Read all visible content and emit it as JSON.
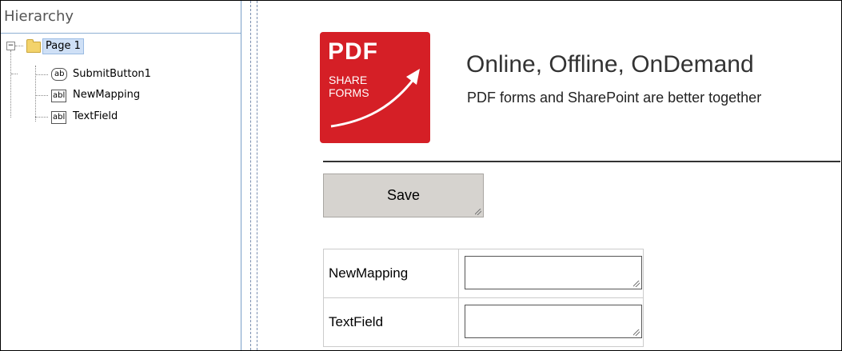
{
  "hierarchy": {
    "title": "Hierarchy",
    "root": {
      "expander": "−",
      "label": "Page 1"
    },
    "children": [
      {
        "icon": "ab",
        "label": "SubmitButton1"
      },
      {
        "icon": "abl",
        "label": "NewMapping"
      },
      {
        "icon": "abl",
        "label": "TextField"
      }
    ]
  },
  "logo": {
    "line1": "PDF",
    "line2": "SHARE",
    "line3": "FORMS",
    "color": "#d51f26"
  },
  "header": {
    "headline": "Online, Offline, OnDemand",
    "tagline": "PDF forms and SharePoint are better together"
  },
  "form": {
    "save_label": "Save",
    "fields": [
      {
        "label": "NewMapping",
        "value": ""
      },
      {
        "label": "TextField",
        "value": ""
      }
    ]
  }
}
